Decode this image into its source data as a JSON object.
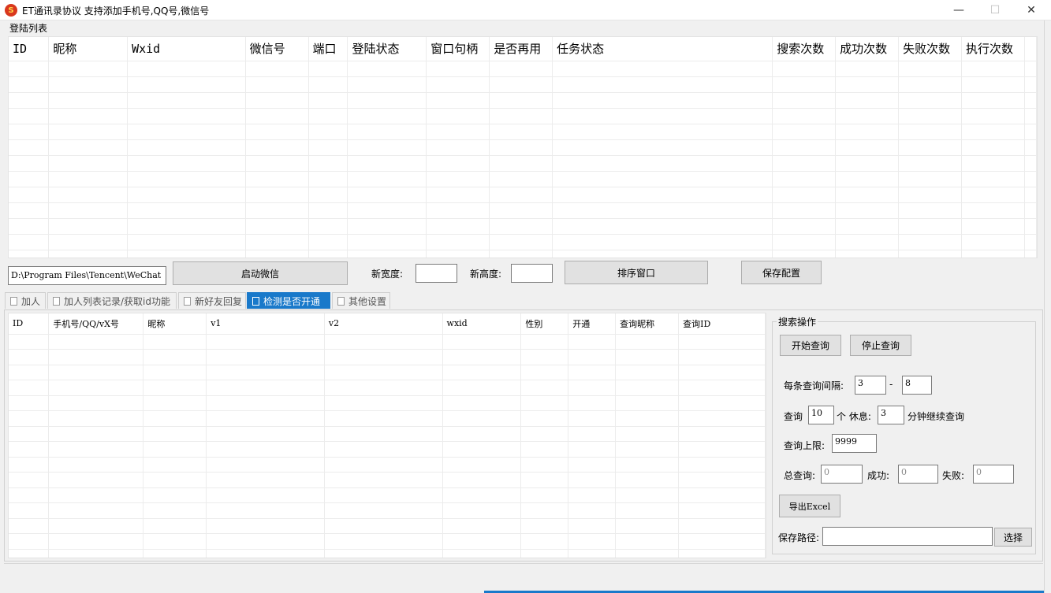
{
  "window": {
    "title": "ET通讯录协议 支持添加手机号,QQ号,微信号",
    "min_glyph": "—",
    "max_glyph": "☐",
    "close_glyph": "✕",
    "app_icon_glyph": "S"
  },
  "login_list": {
    "group_label": "登陆列表",
    "columns": [
      "ID",
      "昵称",
      "Wxid",
      "微信号",
      "端口",
      "登陆状态",
      "窗口句柄",
      "是否再用",
      "任务状态",
      "搜索次数",
      "成功次数",
      "失败次数",
      "执行次数"
    ]
  },
  "launch_bar": {
    "path_value": "D:\\Program Files\\Tencent\\WeChat",
    "launch_button": "启动微信",
    "width_label": "新宽度:",
    "width_value": "",
    "height_label": "新高度:",
    "height_value": "",
    "arrange_button": "排序窗口",
    "save_button": "保存配置"
  },
  "tabs": [
    {
      "label": "加人"
    },
    {
      "label": "加人列表记录/获取id功能"
    },
    {
      "label": "新好友回复"
    },
    {
      "label": "检测是否开通"
    },
    {
      "label": "其他设置"
    }
  ],
  "check_table": {
    "columns": [
      "ID",
      "手机号/QQ/vX号",
      "昵称",
      "v1",
      "v2",
      "wxid",
      "性别",
      "开通",
      "查询昵称",
      "查询ID"
    ]
  },
  "search_panel": {
    "group_label": "搜索操作",
    "start_button": "开始查询",
    "stop_button": "停止查询",
    "interval_label": "每条查询间隔:",
    "interval_min": "3",
    "interval_dash": "-",
    "interval_max": "8",
    "query_label": "查询",
    "query_count": "10",
    "unit_label": "个 休息:",
    "rest_minutes": "3",
    "rest_suffix": "分钟继续查询",
    "limit_label": "查询上限:",
    "limit_value": "9999",
    "total_label": "总查询:",
    "total_value": "0",
    "success_label": "成功:",
    "success_value": "0",
    "fail_label": "失败:",
    "fail_value": "0",
    "export_button": "导出Excel",
    "save_path_label": "保存路径:",
    "save_path_value": "",
    "choose_button": "选择"
  }
}
